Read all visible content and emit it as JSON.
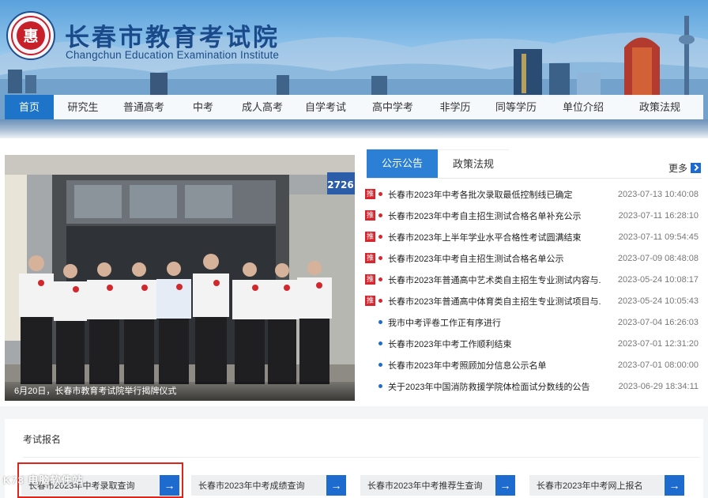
{
  "header": {
    "title_cn": "长春市教育考试院",
    "title_en": "Changchun Education Examination Institute",
    "logo_char": "惠"
  },
  "nav": {
    "items": [
      {
        "label": "首页",
        "active": true
      },
      {
        "label": "研究生"
      },
      {
        "label": "普通高考"
      },
      {
        "label": "中考"
      },
      {
        "label": "成人高考"
      },
      {
        "label": "自学考试"
      },
      {
        "label": "高中学考"
      },
      {
        "label": "非学历"
      },
      {
        "label": "同等学历"
      },
      {
        "label": "单位介绍"
      },
      {
        "label": "政策法规"
      }
    ]
  },
  "photo": {
    "caption": "6月20日，长春市教育考试院举行揭牌仪式",
    "door_number": "2726"
  },
  "notices": {
    "tabs": [
      "公示公告",
      "政策法规"
    ],
    "more_label": "更多",
    "badge_label": "推",
    "items": [
      {
        "title": "长春市2023年中考各批次录取最低控制线已确定",
        "date": "2023-07-13 10:40:08",
        "pinned": true
      },
      {
        "title": "长春市2023年中考自主招生测试合格名单补充公示",
        "date": "2023-07-11 16:28:10",
        "pinned": true
      },
      {
        "title": "长春市2023年上半年学业水平合格性考试圆满结束",
        "date": "2023-07-11 09:54:45",
        "pinned": true
      },
      {
        "title": "长春市2023年中考自主招生测试合格名单公示",
        "date": "2023-07-09 08:48:08",
        "pinned": true
      },
      {
        "title": "长春市2023年普通高中艺术类自主招生专业测试内容与...",
        "date": "2023-05-24 10:08:17",
        "pinned": true
      },
      {
        "title": "长春市2023年普通高中体育类自主招生专业测试项目与...",
        "date": "2023-05-24 10:05:43",
        "pinned": true
      },
      {
        "title": "我市中考评卷工作正有序进行",
        "date": "2023-07-04 16:26:03",
        "pinned": false
      },
      {
        "title": "长春市2023年中考工作顺利结束",
        "date": "2023-07-01 12:31:20",
        "pinned": false
      },
      {
        "title": "长春市2023年中考照顾加分信息公示名单",
        "date": "2023-07-01 08:00:00",
        "pinned": false
      },
      {
        "title": "关于2023年中国消防救援学院体检面试分数线的公告",
        "date": "2023-06-29 18:34:11",
        "pinned": false
      }
    ]
  },
  "exam": {
    "section_title": "考试报名",
    "buttons": [
      {
        "label": "长春市2023年中考录取查询"
      },
      {
        "label": "长春市2023年中考成绩查询"
      },
      {
        "label": "长春市2023年中考推荐生查询"
      },
      {
        "label": "长春市2023年中考网上报名"
      }
    ],
    "arrow": "→"
  },
  "watermark": "K73 电脑软件站",
  "colors": {
    "nav_active": "#1e74c9",
    "tab_active": "#2b7fd4",
    "badge_red": "#d8262e",
    "arrow_blue": "#1e6bd0",
    "highlight_red": "#e0241c"
  }
}
